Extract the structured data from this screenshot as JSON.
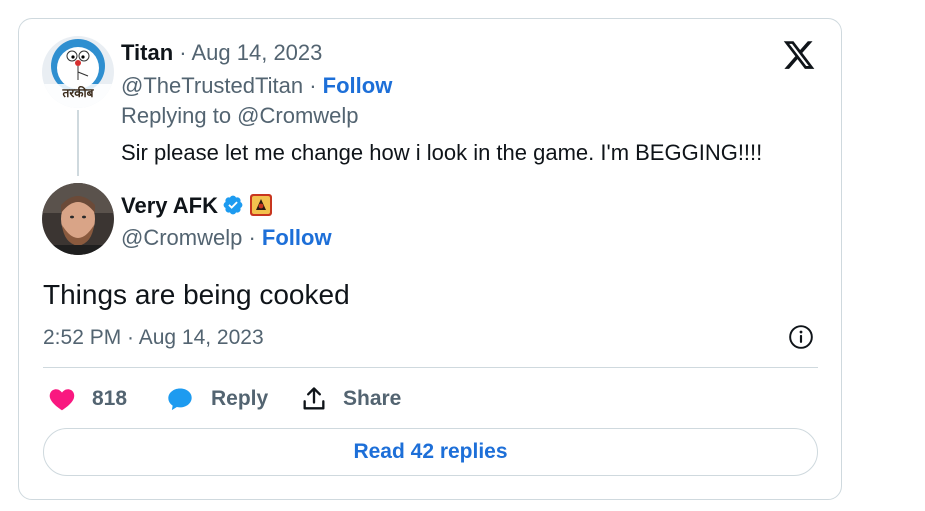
{
  "reply_to_tweet": {
    "author_name": "Titan",
    "date": " · Aug 14, 2023",
    "handle": "@TheTrustedTitan",
    "separator": " · ",
    "follow_label": "Follow",
    "replying_to": "Replying to @Cromwelp",
    "text": "Sir please let me change how i look in the game. I'm BEGGING!!!!",
    "avatar_text": "तरकीब"
  },
  "main_tweet": {
    "author_name": "Very AFK",
    "handle": "@Cromwelp",
    "separator": " · ",
    "follow_label": "Follow",
    "text": "Things are being cooked",
    "timestamp": "2:52 PM · Aug 14, 2023"
  },
  "actions": {
    "like_count": "818",
    "reply_label": "Reply",
    "share_label": "Share"
  },
  "read_replies_label": "Read 42 replies",
  "icons": {
    "brand": "x-logo-icon",
    "info": "info-icon",
    "like": "heart-icon",
    "reply": "reply-bubble-icon",
    "share": "share-upload-icon",
    "verified": "verified-badge-icon"
  },
  "colors": {
    "like": "#f91880",
    "reply": "#1d9bf0",
    "link": "#1d6fd8",
    "muted": "#536471",
    "border": "#cfd9de"
  }
}
